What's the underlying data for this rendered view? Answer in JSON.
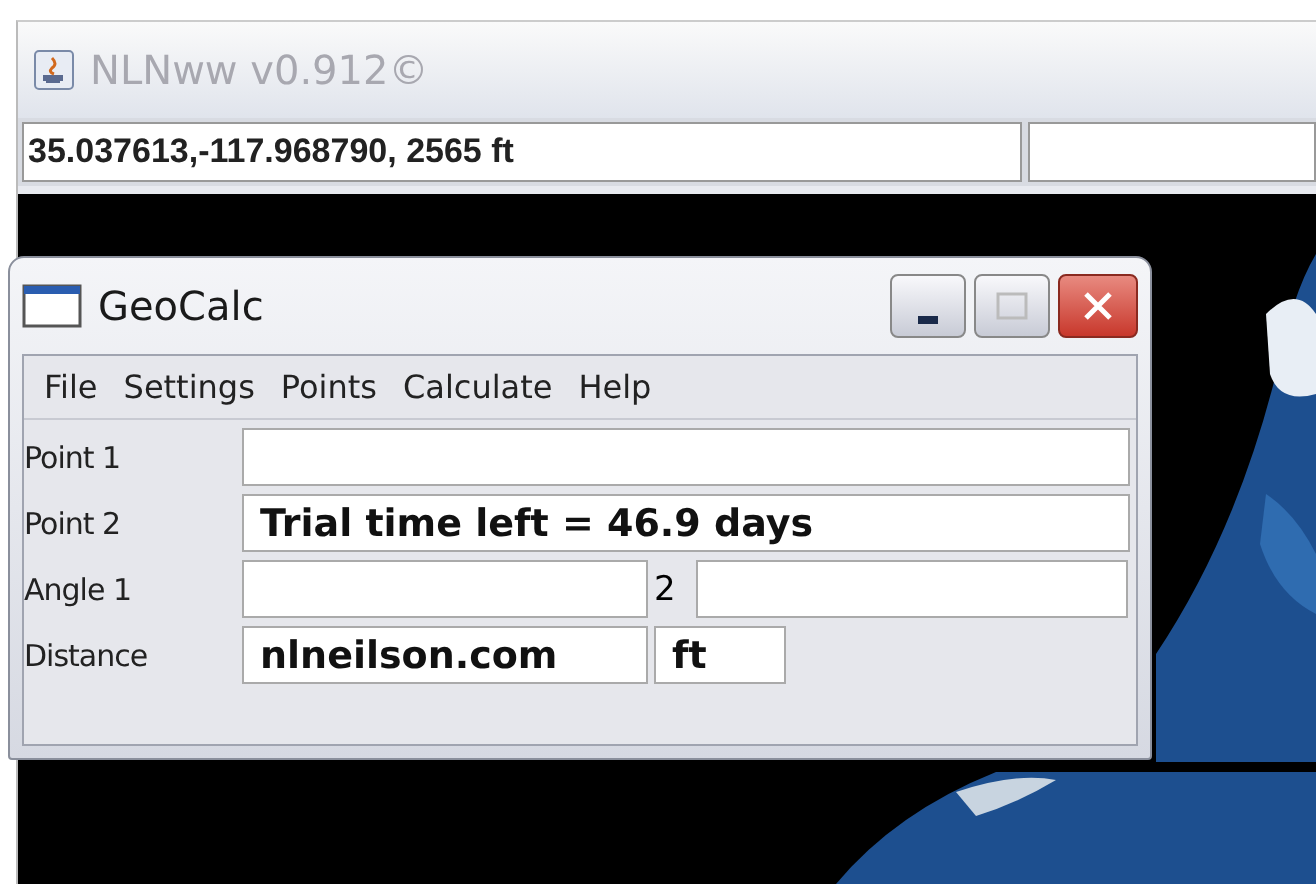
{
  "main_window": {
    "title": "NLNww v0.912©",
    "coordinates": "35.037613,-117.968790, 2565 ft"
  },
  "geocalc": {
    "title": "GeoCalc",
    "menu": [
      "File",
      "Settings",
      "Points",
      "Calculate",
      "Help"
    ],
    "rows": [
      {
        "kind": "single",
        "label": "Point 1"
      },
      {
        "kind": "single",
        "label": "Point 2",
        "value": "Trial time left = 46.9 days"
      },
      {
        "kind": "split",
        "label": "Angle 1",
        "label_2": "2"
      },
      {
        "kind": "unit",
        "label": "Distance",
        "value": "nlneilson.com",
        "unit": "ft"
      }
    ]
  }
}
